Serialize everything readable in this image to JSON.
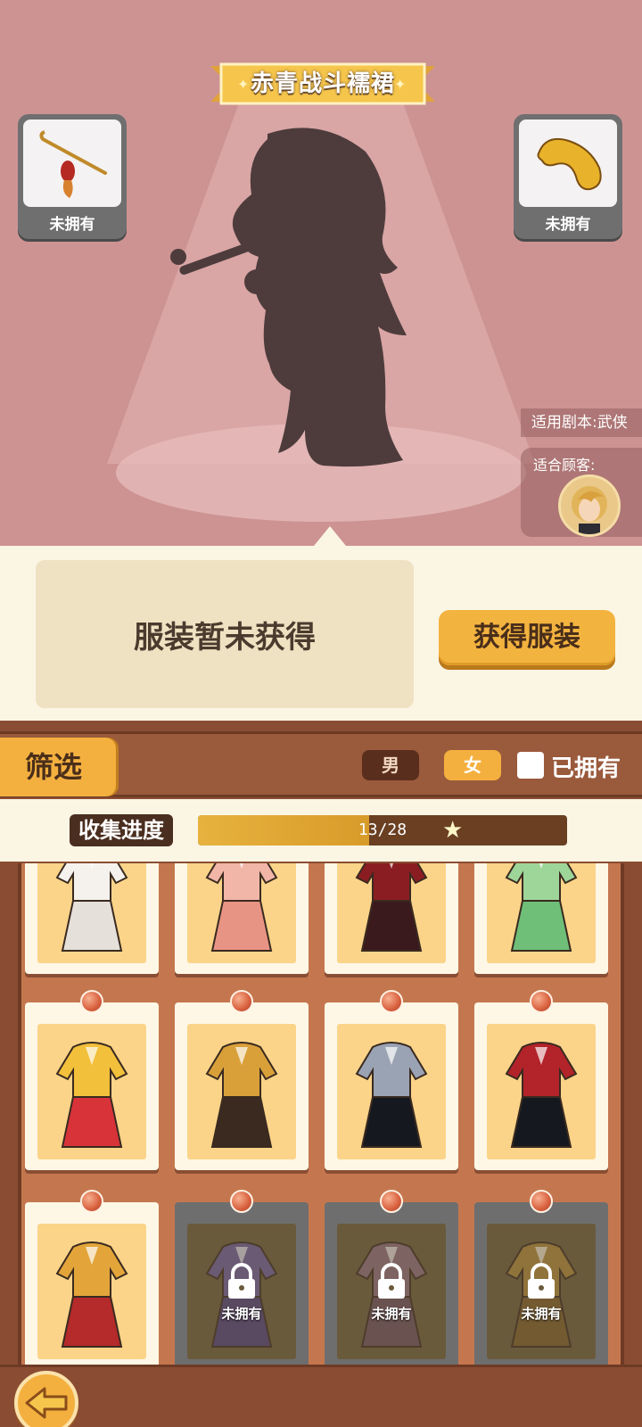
{
  "outfit": {
    "name": "赤青战斗襦裙",
    "status_text": "服装暂未获得",
    "obtain_button": "获得服装"
  },
  "accessories": {
    "left": {
      "label": "未拥有",
      "icon": "pipe-accessory-icon"
    },
    "right": {
      "label": "未拥有",
      "icon": "golden-bracelet-icon"
    }
  },
  "info": {
    "script": "适用剧本:武侠",
    "customer_label": "适合顾客:"
  },
  "filter": {
    "label": "筛选",
    "male": "男",
    "female": "女",
    "owned": "已拥有",
    "selected_gender": "female"
  },
  "progress": {
    "label": "收集进度",
    "text": "13/28",
    "current": 13,
    "total": 28
  },
  "items": [
    {
      "name": "white-robe",
      "owned": true,
      "label": ""
    },
    {
      "name": "pink-dress",
      "owned": true,
      "label": ""
    },
    {
      "name": "dark-red-robe",
      "owned": true,
      "label": ""
    },
    {
      "name": "green-dress",
      "owned": true,
      "label": ""
    },
    {
      "name": "gold-hanfu-red-skirt",
      "owned": true,
      "label": ""
    },
    {
      "name": "yellow-blazer-brown-skirt",
      "owned": true,
      "label": ""
    },
    {
      "name": "black-pinafore-dress",
      "owned": true,
      "label": ""
    },
    {
      "name": "red-vest-black-dress",
      "owned": true,
      "label": ""
    },
    {
      "name": "yellow-blazer-plaid-skirt",
      "owned": true,
      "label": ""
    },
    {
      "name": "purple-robe",
      "owned": false,
      "label": "未拥有"
    },
    {
      "name": "mauve-robe",
      "owned": false,
      "label": "未拥有"
    },
    {
      "name": "gold-robe",
      "owned": false,
      "label": "未拥有"
    }
  ],
  "colors": {
    "stage_bg": "#cd9393",
    "accent_gold": "#f4b03f",
    "wood": "#8a4d33"
  }
}
